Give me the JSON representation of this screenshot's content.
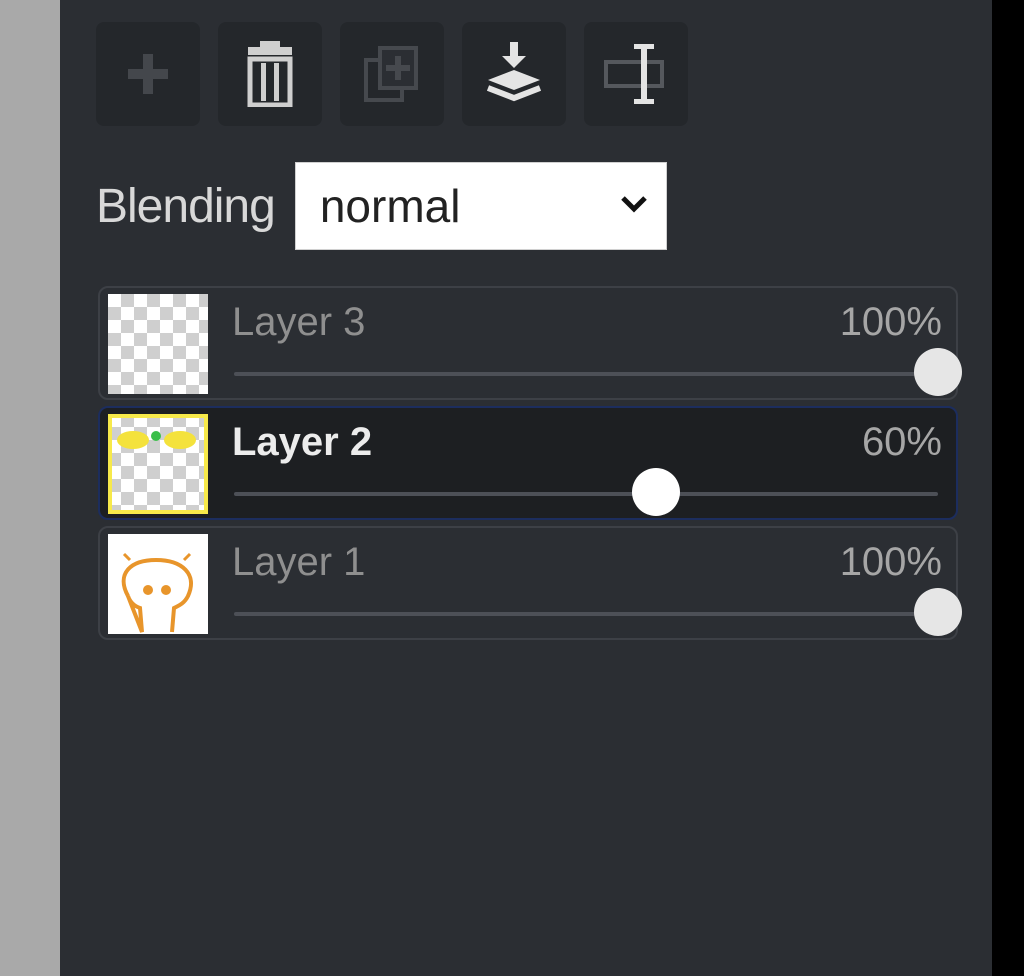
{
  "toolbar": {
    "buttons": [
      {
        "icon": "plus-icon",
        "enabled": false
      },
      {
        "icon": "trash-icon",
        "enabled": true
      },
      {
        "icon": "duplicate-icon",
        "enabled": false
      },
      {
        "icon": "merge-down-icon",
        "enabled": true
      },
      {
        "icon": "rename-icon",
        "enabled": true
      }
    ]
  },
  "blending": {
    "label": "Blending",
    "value": "normal"
  },
  "layers": [
    {
      "name": "Layer 3",
      "opacity_label": "100%",
      "opacity": 1.0,
      "active": false
    },
    {
      "name": "Layer 2",
      "opacity_label": "60%",
      "opacity": 0.6,
      "active": true
    },
    {
      "name": "Layer 1",
      "opacity_label": "100%",
      "opacity": 1.0,
      "active": false
    }
  ],
  "colors": {
    "panel_bg": "#2b2e33",
    "active_layer_bg": "#1d1f22",
    "active_thumb_border": "#f7e94a",
    "drawing_orange": "#e8952b"
  }
}
